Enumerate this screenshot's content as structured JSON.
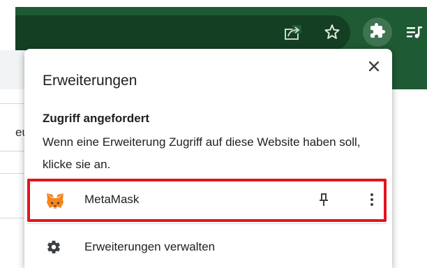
{
  "page": {
    "partial_text": "eu"
  },
  "toolbar": {
    "icons": [
      "share-icon",
      "star-icon",
      "extensions-icon",
      "reading-list-icon"
    ]
  },
  "popup": {
    "title": "Erweiterungen",
    "close_icon": "close-icon",
    "section_title": "Zugriff angefordert",
    "section_description": "Wenn eine Erweiterung Zugriff auf diese Website haben soll, klicke sie an.",
    "extensions": [
      {
        "name": "MetaMask",
        "icon": "metamask-fox-icon",
        "highlight_color": "#e2141f"
      }
    ],
    "manage_label": "Erweiterungen verwalten",
    "manage_icon": "gear-icon"
  },
  "colors": {
    "toolbar_green": "#1e5a33",
    "highlight_red": "#e2141f"
  }
}
